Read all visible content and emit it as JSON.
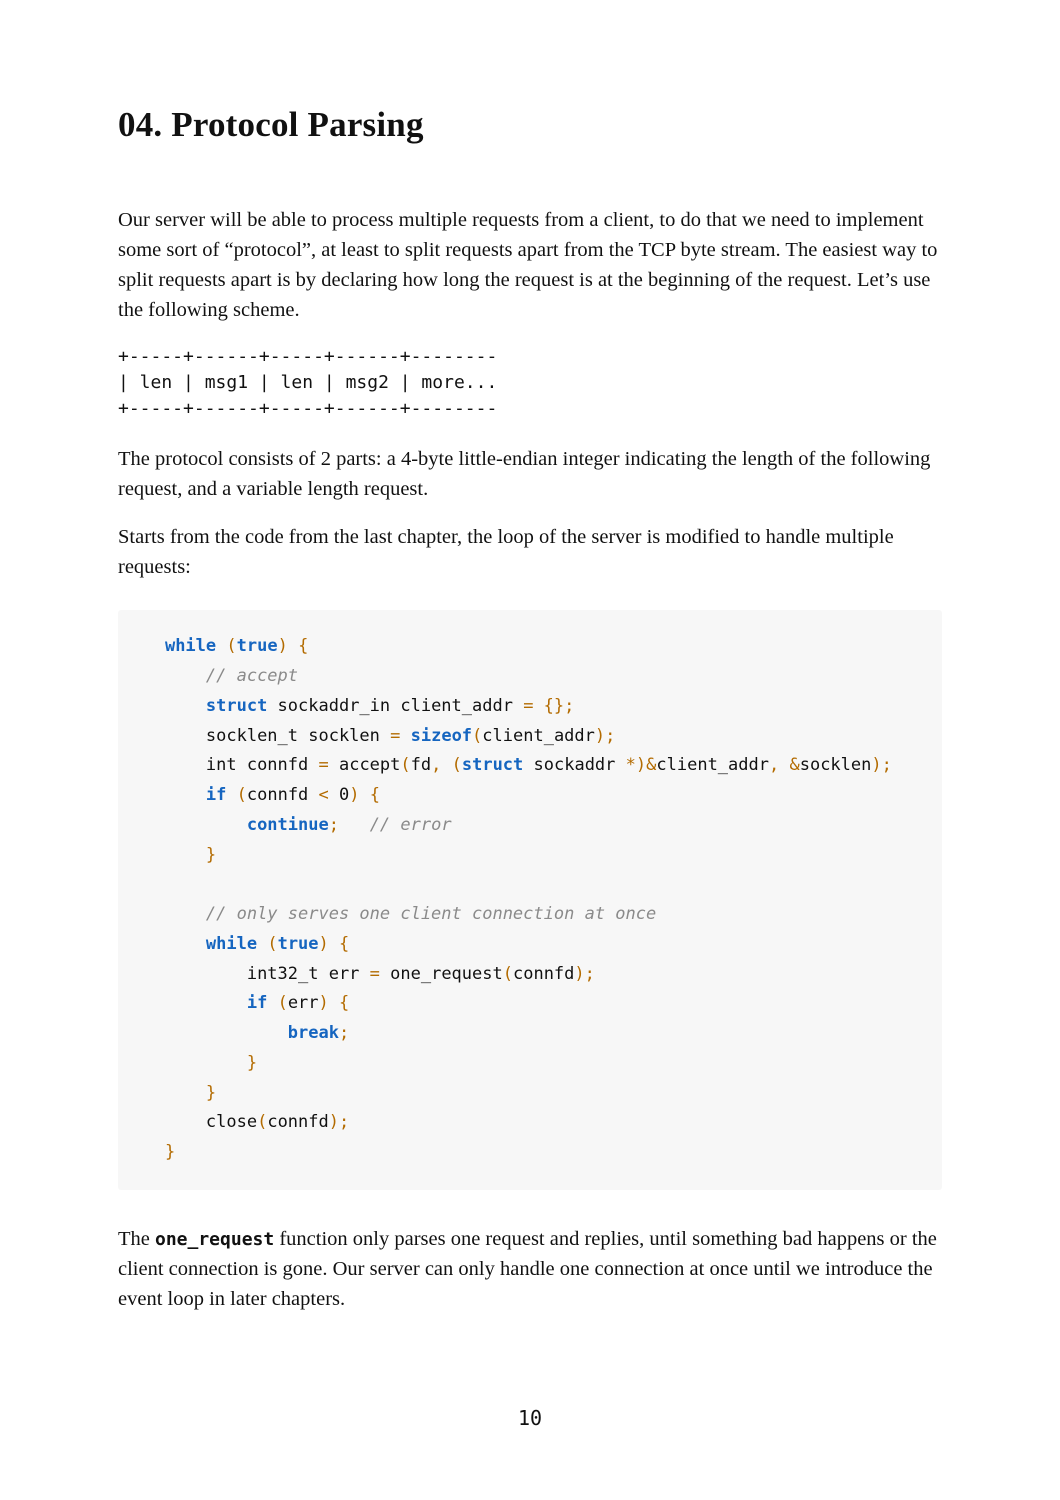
{
  "title": "04. Protocol Parsing",
  "paragraphs": {
    "p1": "Our server will be able to process multiple requests from a client, to do that we need to implement some sort of “protocol”, at least to split requests apart from the TCP byte stream. The easiest way to split requests apart is by declaring how long the request is at the beginning of the request. Let’s use the following scheme.",
    "diagram": "+-----+------+-----+------+--------\n| len | msg1 | len | msg2 | more...\n+-----+------+-----+------+--------",
    "p2": "The protocol consists of 2 parts: a 4-byte little-endian integer indicating the length of the following request, and a variable length request.",
    "p3": "Starts from the code from the last chapter, the loop of the server is modified to handle multiple requests:",
    "p4_pre": "The ",
    "p4_code": "one_request",
    "p4_post": " function only parses one request and replies, until something bad happens or the client connection is gone. Our server can only handle one connection at once until we introduce the event loop in later chapters."
  },
  "code": {
    "kw_while": "while",
    "kw_true": "true",
    "cmt_accept": "// accept",
    "kw_struct": "struct",
    "id_sockaddr_in": " sockaddr_in client_addr ",
    "op_eq": "=",
    "empty_braces_l": " {",
    "empty_braces_r": "}",
    "semi": ";",
    "line3_a": "socklen_t socklen ",
    "kw_sizeof": "sizeof",
    "line3_b": "client_addr",
    "line4_a": "int connfd ",
    "line4_b": " accept",
    "line4_c": "fd",
    "line4_d": "struct",
    "line4_e": " sockaddr ",
    "star": "*",
    "amp": "&",
    "line4_f": "client_addr",
    "line4_g": "socklen",
    "kw_if": "if",
    "line5_a": "connfd ",
    "lt": "<",
    "zero": " 0",
    "kw_continue": "continue",
    "cmt_error": "// error",
    "cmt_only": "// only serves one client connection at once",
    "line_err_a": "int32_t err ",
    "line_err_b": " one_request",
    "line_err_c": "connfd",
    "line_if_err": "err",
    "kw_break": "break",
    "close_a": "close",
    "close_b": "connfd",
    "paren_l": "(",
    "paren_r": ")",
    "brace_l": "{",
    "brace_r": "}",
    "comma": ", ",
    "sp": " "
  },
  "page_number": "10"
}
